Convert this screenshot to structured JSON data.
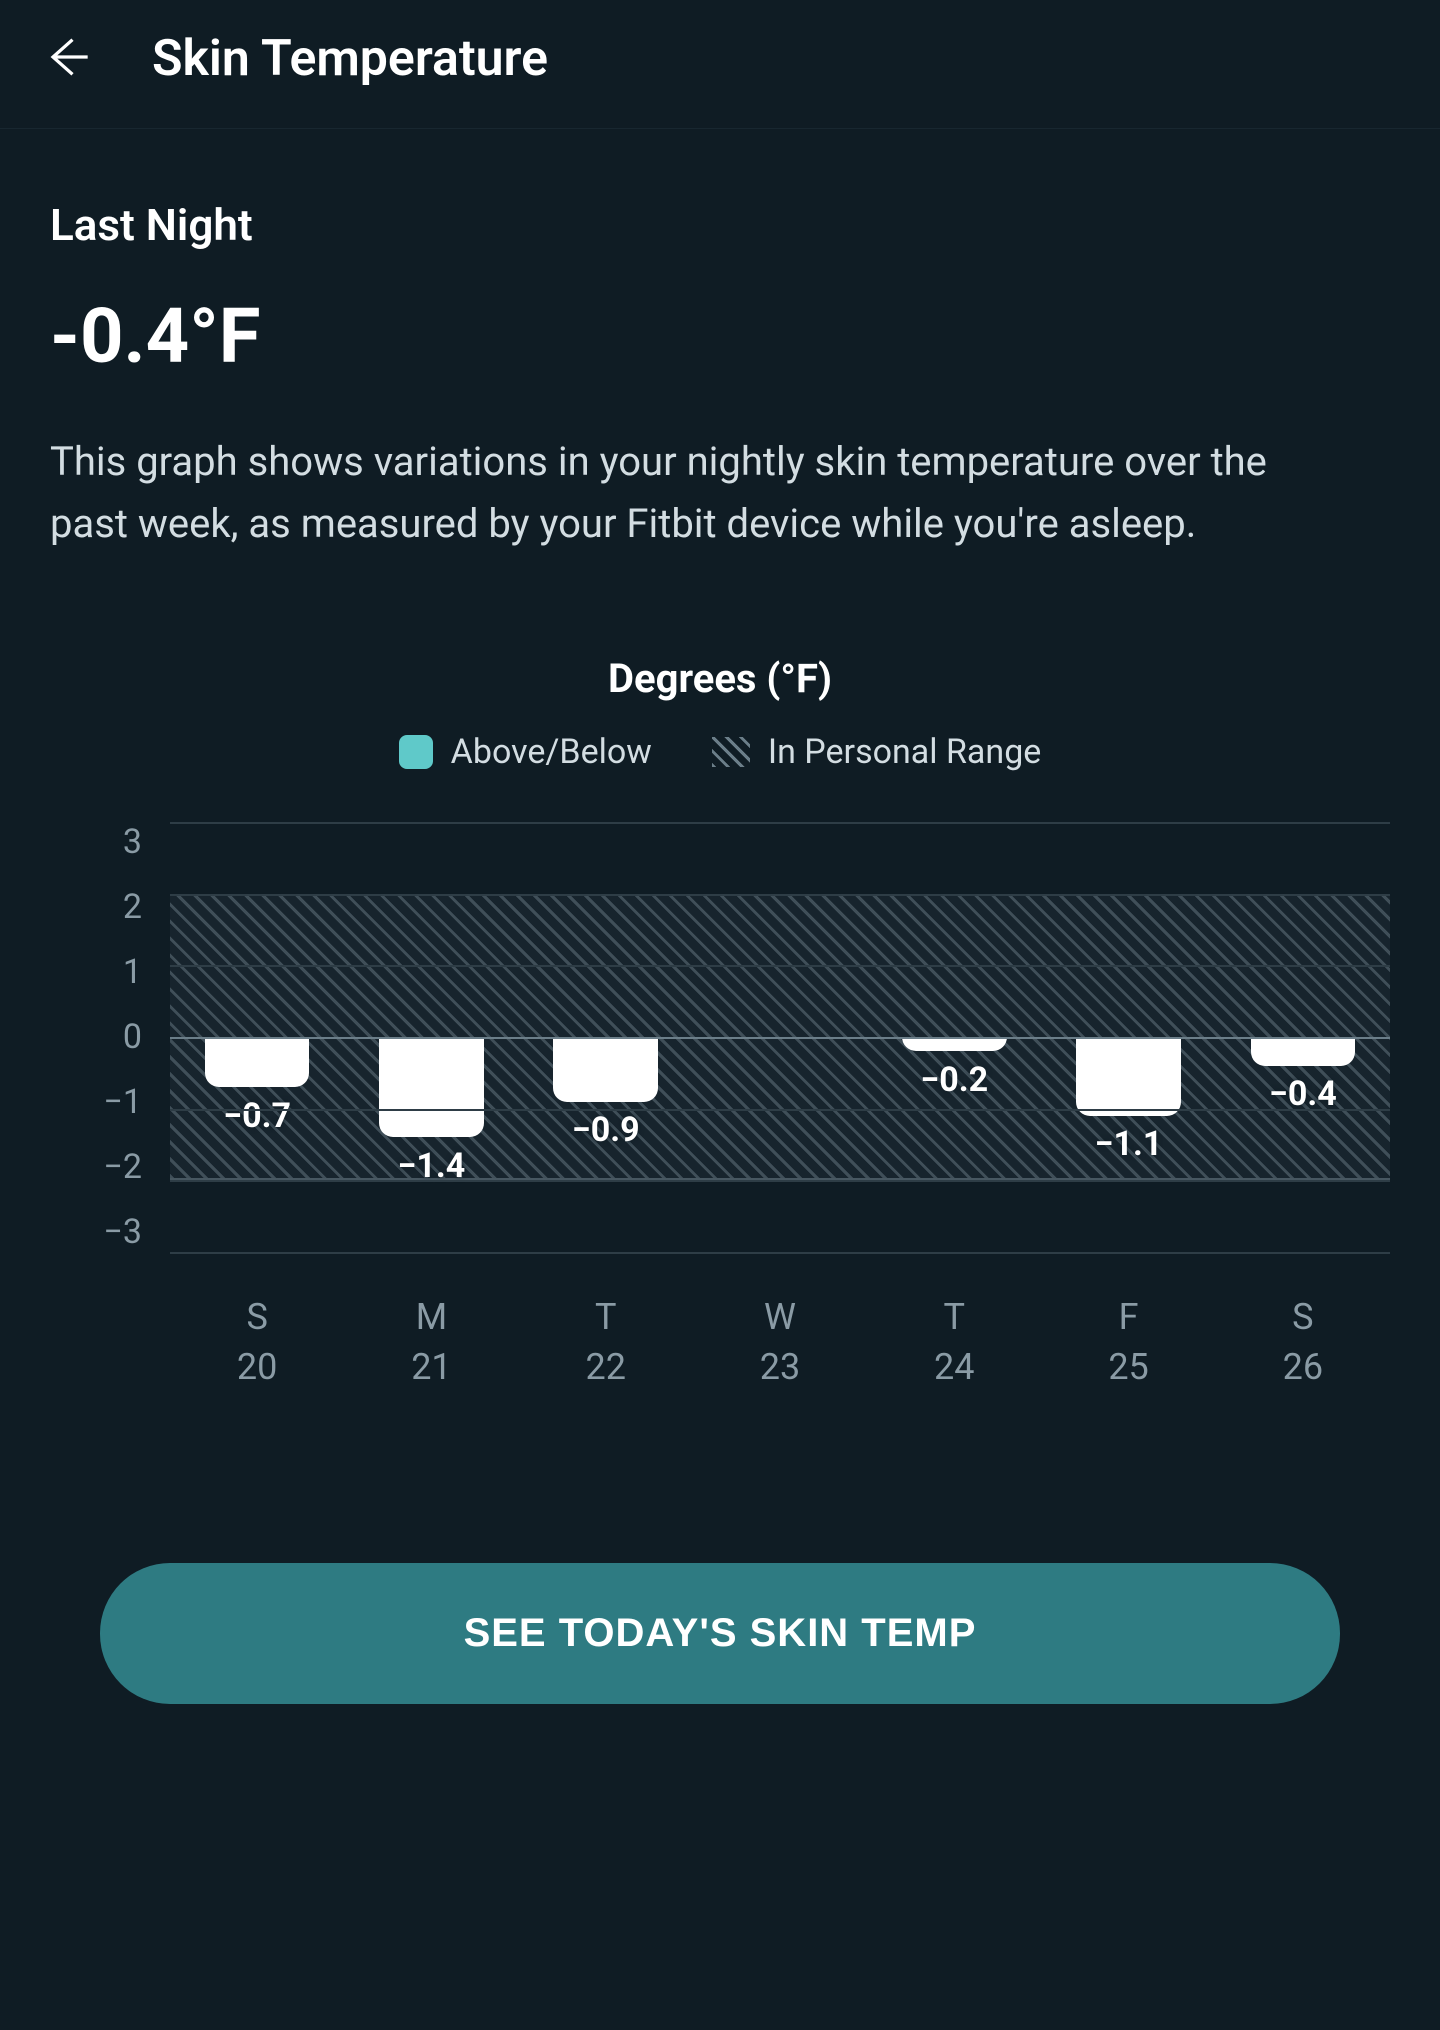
{
  "header": {
    "title": "Skin Temperature"
  },
  "summary": {
    "label": "Last Night",
    "value": "-0.4°F",
    "description": "This graph shows variations in your nightly skin temperature over the past week, as measured by your Fitbit device while you're asleep."
  },
  "chart": {
    "title": "Degrees (°F)",
    "legend": {
      "above_below": "Above/Below",
      "in_range": "In Personal Range"
    }
  },
  "cta": {
    "label": "SEE TODAY'S SKIN TEMP"
  },
  "chart_data": {
    "type": "bar",
    "title": "Degrees (°F)",
    "xlabel": "",
    "ylabel": "",
    "ylim": [
      -3,
      3
    ],
    "y_ticks": [
      3,
      2,
      1,
      0,
      -1,
      -2,
      -3
    ],
    "personal_range": {
      "low": -2,
      "high": 2
    },
    "categories": [
      {
        "day": "S",
        "date": "20"
      },
      {
        "day": "M",
        "date": "21"
      },
      {
        "day": "T",
        "date": "22"
      },
      {
        "day": "W",
        "date": "23"
      },
      {
        "day": "T",
        "date": "24"
      },
      {
        "day": "F",
        "date": "25"
      },
      {
        "day": "S",
        "date": "26"
      }
    ],
    "values": [
      -0.7,
      -1.4,
      -0.9,
      null,
      -0.2,
      -1.1,
      -0.4
    ],
    "value_labels": [
      "−0.7",
      "−1.4",
      "−0.9",
      "",
      "−0.2",
      "−1.1",
      "−0.4"
    ]
  }
}
